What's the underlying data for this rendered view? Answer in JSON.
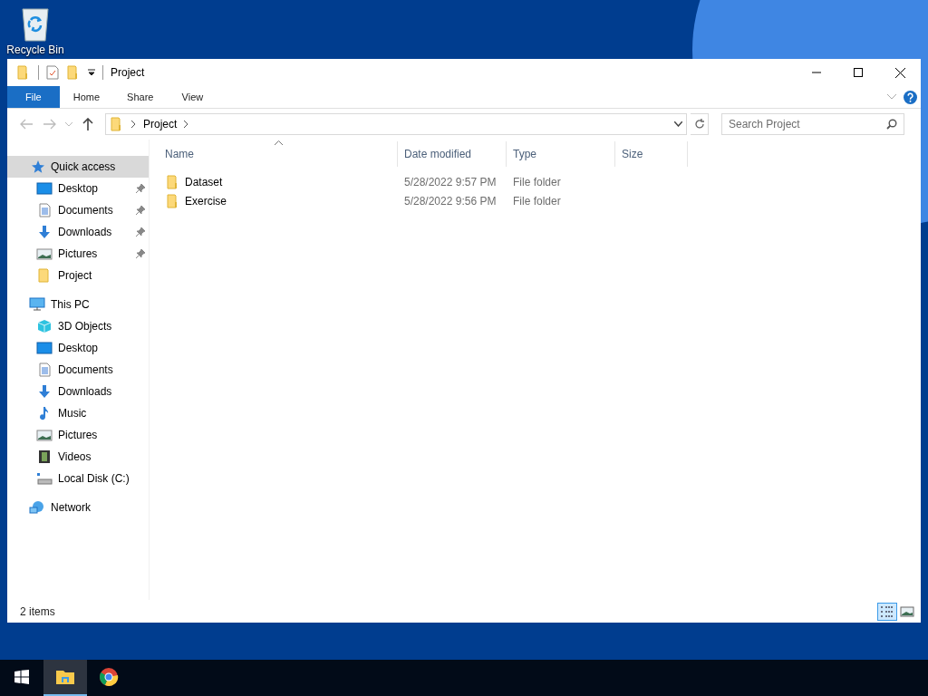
{
  "desktop": {
    "icons": [
      {
        "label": "Recycle Bin"
      }
    ]
  },
  "window": {
    "title": "Project"
  },
  "ribbon_tabs": [
    {
      "label": "File",
      "selected": true
    },
    {
      "label": "Home",
      "selected": false
    },
    {
      "label": "Share",
      "selected": false
    },
    {
      "label": "View",
      "selected": false
    }
  ],
  "address": {
    "path": [
      {
        "label": "Project"
      }
    ]
  },
  "search": {
    "placeholder": "Search Project"
  },
  "nav": [
    {
      "label": "Quick access",
      "kind": "quick",
      "selected": true,
      "children": [
        {
          "label": "Desktop",
          "kind": "desktop",
          "pinned": true,
          "selected": false
        },
        {
          "label": "Documents",
          "kind": "documents",
          "pinned": true,
          "selected": false
        },
        {
          "label": "Downloads",
          "kind": "downloads",
          "pinned": true,
          "selected": false
        },
        {
          "label": "Pictures",
          "kind": "pictures",
          "pinned": true,
          "selected": false
        },
        {
          "label": "Project",
          "kind": "folder",
          "pinned": false,
          "selected": false
        }
      ]
    },
    {
      "label": "This PC",
      "kind": "pc",
      "selected": false,
      "children": [
        {
          "label": "3D Objects",
          "kind": "objects",
          "pinned": false,
          "selected": false
        },
        {
          "label": "Desktop",
          "kind": "desktop",
          "pinned": false,
          "selected": false
        },
        {
          "label": "Documents",
          "kind": "documents",
          "pinned": false,
          "selected": false
        },
        {
          "label": "Downloads",
          "kind": "downloads",
          "pinned": false,
          "selected": false
        },
        {
          "label": "Music",
          "kind": "music",
          "pinned": false,
          "selected": false
        },
        {
          "label": "Pictures",
          "kind": "pictures",
          "pinned": false,
          "selected": false
        },
        {
          "label": "Videos",
          "kind": "videos",
          "pinned": false,
          "selected": false
        },
        {
          "label": "Local Disk (C:)",
          "kind": "disk",
          "pinned": false,
          "selected": false
        }
      ]
    },
    {
      "label": "Network",
      "kind": "network",
      "selected": false
    }
  ],
  "columns": [
    {
      "label": "Name",
      "sorted": true
    },
    {
      "label": "Date modified",
      "sorted": false
    },
    {
      "label": "Type",
      "sorted": false
    },
    {
      "label": "Size",
      "sorted": false
    }
  ],
  "rows": [
    {
      "name": "Dataset",
      "date": "5/28/2022 9:57 PM",
      "type": "File folder"
    },
    {
      "name": "Exercise",
      "date": "5/28/2022 9:56 PM",
      "type": "File folder"
    }
  ],
  "status_bar": {
    "text": "2 items",
    "views": [
      {
        "kind": "details",
        "selected": true
      },
      {
        "kind": "large",
        "selected": false
      }
    ]
  },
  "taskbar": {
    "apps": [
      {
        "kind": "explorer",
        "selected": true
      },
      {
        "kind": "chrome",
        "selected": false
      }
    ]
  }
}
